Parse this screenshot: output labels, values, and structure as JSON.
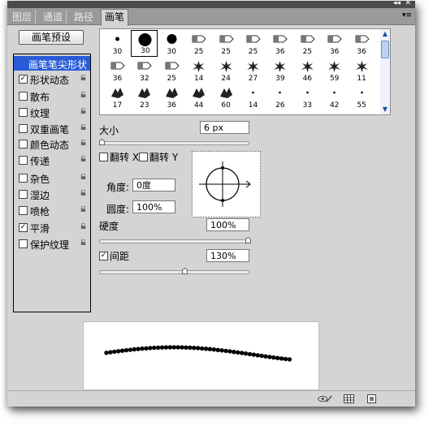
{
  "tabs": [
    {
      "label": "图层",
      "active": false
    },
    {
      "label": "通道",
      "active": false
    },
    {
      "label": "路径",
      "active": false
    },
    {
      "label": "画笔",
      "active": true
    }
  ],
  "titlebar": {
    "collapse": "◂◂",
    "close": "✕"
  },
  "preset_button": "画笔预设",
  "left_items": [
    {
      "label": "画笔笔尖形状",
      "checkbox": false,
      "checked": false,
      "lock": false,
      "selected": true
    },
    {
      "label": "形状动态",
      "checkbox": true,
      "checked": true,
      "lock": true,
      "selected": false
    },
    {
      "label": "散布",
      "checkbox": true,
      "checked": false,
      "lock": true,
      "selected": false
    },
    {
      "label": "纹理",
      "checkbox": true,
      "checked": false,
      "lock": true,
      "selected": false
    },
    {
      "label": "双重画笔",
      "checkbox": true,
      "checked": false,
      "lock": true,
      "selected": false
    },
    {
      "label": "颜色动态",
      "checkbox": true,
      "checked": false,
      "lock": true,
      "selected": false
    },
    {
      "label": "传递",
      "checkbox": true,
      "checked": false,
      "lock": true,
      "selected": false
    },
    {
      "label": "杂色",
      "checkbox": true,
      "checked": false,
      "lock": true,
      "selected": false
    },
    {
      "label": "湿边",
      "checkbox": true,
      "checked": false,
      "lock": true,
      "selected": false
    },
    {
      "label": "喷枪",
      "checkbox": true,
      "checked": false,
      "lock": true,
      "selected": false
    },
    {
      "label": "平滑",
      "checkbox": true,
      "checked": true,
      "lock": true,
      "selected": false
    },
    {
      "label": "保护纹理",
      "checkbox": true,
      "checked": false,
      "lock": true,
      "selected": false
    }
  ],
  "brush_sizes": [
    [
      "30",
      "30",
      "30",
      "25",
      "25",
      "25",
      "36",
      "25",
      "36",
      "36"
    ],
    [
      "36",
      "32",
      "25",
      "14",
      "24",
      "27",
      "39",
      "46",
      "59",
      "11"
    ],
    [
      "17",
      "23",
      "36",
      "44",
      "60",
      "14",
      "26",
      "33",
      "42",
      "55"
    ]
  ],
  "size": {
    "label": "大小",
    "value": "6 px",
    "slider": 0.02
  },
  "flip_x": {
    "label": "翻转 X",
    "checked": false
  },
  "flip_y": {
    "label": "翻转 Y",
    "checked": false
  },
  "angle": {
    "label": "角度:",
    "value": "0度"
  },
  "roundness": {
    "label": "圆度:",
    "value": "100%"
  },
  "hardness": {
    "label": "硬度",
    "value": "100%",
    "slider": 1.0
  },
  "spacing": {
    "label": "间距",
    "value": "130%",
    "checked": true,
    "slider": 0.57
  },
  "colors": {
    "panel": "#d4d4d4",
    "selected": "#2a5bd7",
    "tab_bar": "#9a9a9a"
  }
}
